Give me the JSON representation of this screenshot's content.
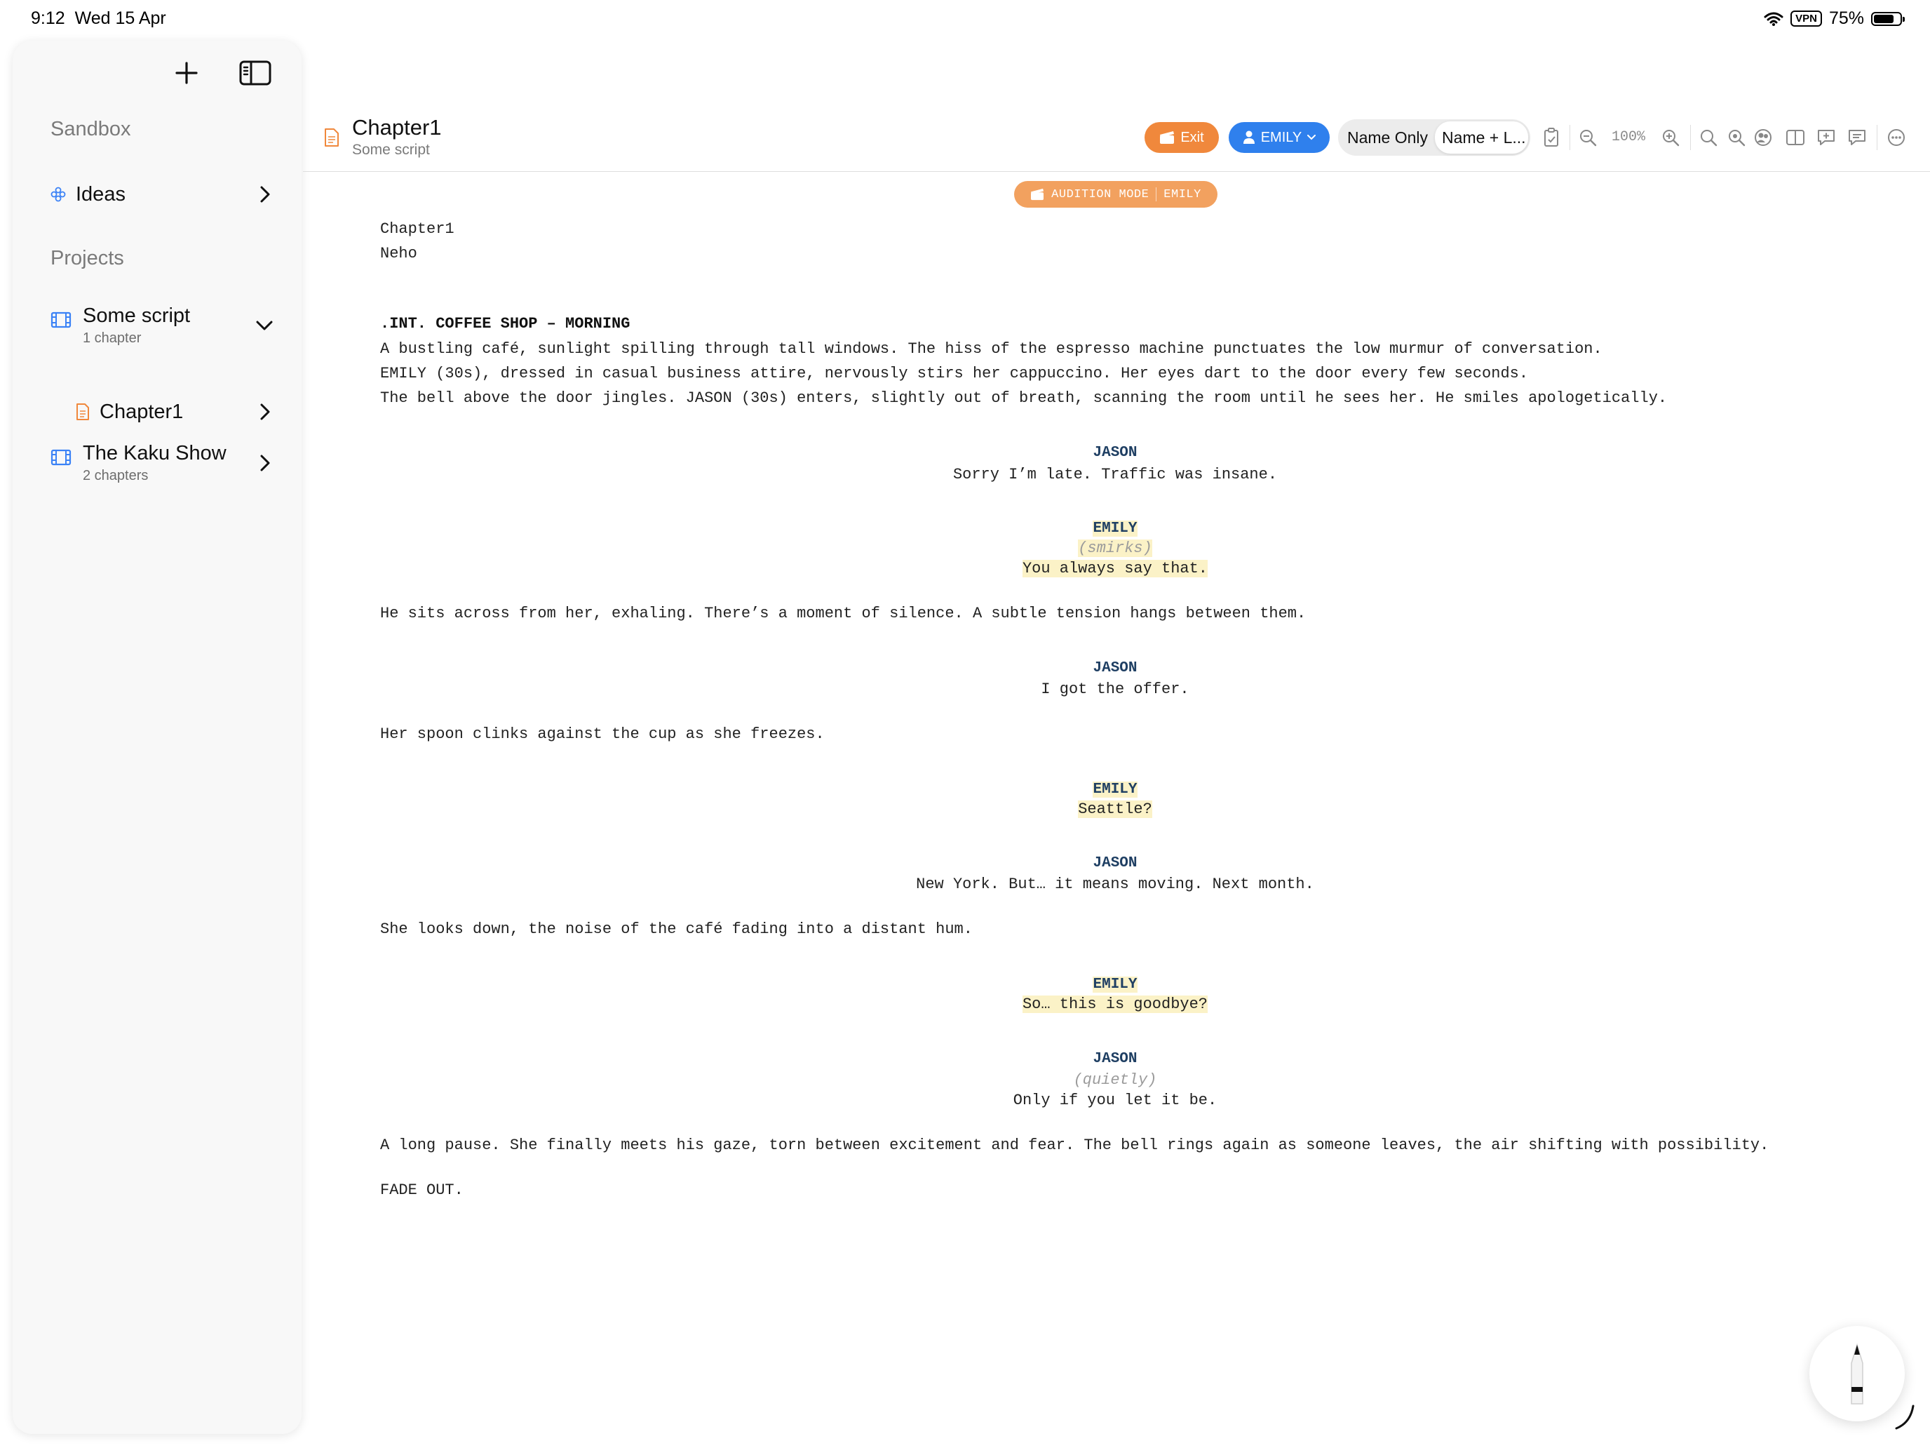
{
  "status_bar": {
    "time": "9:12",
    "date": "Wed 15 Apr",
    "vpn": "VPN",
    "battery": "75%"
  },
  "sidebar": {
    "sandbox_header": "Sandbox",
    "ideas_label": "Ideas",
    "projects_header": "Projects",
    "projects": [
      {
        "title": "Some script",
        "subtitle": "1 chapter",
        "children": [
          {
            "title": "Chapter1"
          }
        ]
      },
      {
        "title": "The Kaku Show",
        "subtitle": "2 chapters"
      }
    ]
  },
  "header": {
    "title": "Chapter1",
    "subtitle": "Some script",
    "exit_label": "Exit",
    "character_label": "EMILY",
    "segment": {
      "option1": "Name Only",
      "option2": "Name + L..."
    },
    "zoom": "100%"
  },
  "badge": {
    "mode": "AUDITION MODE",
    "character": "EMILY"
  },
  "script": {
    "title_lines": [
      "Chapter1",
      "Neho"
    ],
    "scene_heading": ".INT. COFFEE SHOP – MORNING",
    "action1": [
      "A bustling café, sunlight spilling through tall windows. The hiss of the espresso machine punctuates the low murmur of conversation.",
      "EMILY (30s), dressed in casual business attire, nervously stirs her cappuccino. Her eyes dart to the door every few seconds.",
      "The bell above the door jingles. JASON (30s) enters, slightly out of breath, scanning the room until he sees her. He smiles apologetically."
    ],
    "d1": {
      "name": "JASON",
      "line": "Sorry I’m late. Traffic was insane."
    },
    "d2": {
      "name": "EMILY",
      "paren": "(smirks)",
      "line": "You always say that."
    },
    "action2": "He sits across from her, exhaling. There’s a moment of silence. A subtle tension hangs between them.",
    "d3": {
      "name": "JASON",
      "line": "I got the offer."
    },
    "action3": "Her spoon clinks against the cup as she freezes.",
    "d4": {
      "name": "EMILY",
      "line": "Seattle?"
    },
    "d5": {
      "name": "JASON",
      "line": "New York. But… it means moving. Next month."
    },
    "action4": "She looks down, the noise of the café fading into a distant hum.",
    "d6": {
      "name": "EMILY",
      "line": "So… this is goodbye?"
    },
    "d7": {
      "name": "JASON",
      "paren": "(quietly)",
      "line": "Only if you let it be."
    },
    "action5": "A long pause. She finally meets his gaze, torn between excitement and fear. The bell rings again as someone leaves, the air shifting with possibility.",
    "transition": "FADE OUT."
  }
}
